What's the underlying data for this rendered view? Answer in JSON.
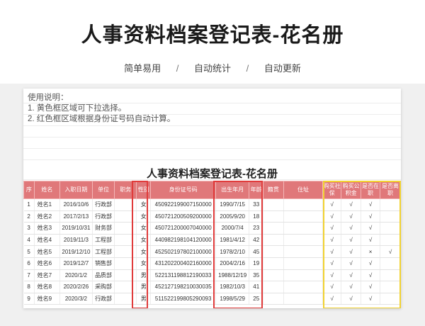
{
  "header": {
    "title": "人事资料档案登记表-花名册",
    "features": [
      "简单易用",
      "自动统计",
      "自动更新"
    ],
    "separator": "/"
  },
  "sheet": {
    "instructions": [
      "使用说明：",
      "1. 黄色框区域可下拉选择。",
      "2. 红色框区域根据身份证号码自动计算。"
    ],
    "title": "人事资料档案登记表-花名册",
    "columns": [
      "序",
      "姓名",
      "入职日期",
      "单位",
      "职务",
      "性别",
      "身份证号码",
      "出生年月",
      "年龄",
      "籍贯",
      "住址",
      "购买社保",
      "购买公积金",
      "是否在职",
      "是否离职"
    ],
    "rows": [
      [
        "1",
        "姓名1",
        "2016/10/6",
        "行政部",
        "",
        "女",
        "450922199007150000",
        "1990/7/15",
        "33",
        "",
        "",
        "√",
        "√",
        "√",
        ""
      ],
      [
        "2",
        "姓名2",
        "2017/2/13",
        "行政部",
        "",
        "女",
        "450721200509200000",
        "2005/9/20",
        "18",
        "",
        "",
        "√",
        "√",
        "√",
        ""
      ],
      [
        "3",
        "姓名3",
        "2019/10/31",
        "财务部",
        "",
        "女",
        "450721200007040000",
        "2000/7/4",
        "23",
        "",
        "",
        "√",
        "√",
        "√",
        ""
      ],
      [
        "4",
        "姓名4",
        "2019/11/3",
        "工程部",
        "",
        "女",
        "440982198104120000",
        "1981/4/12",
        "42",
        "",
        "",
        "√",
        "√",
        "√",
        ""
      ],
      [
        "5",
        "姓名5",
        "2019/12/10",
        "工程部",
        "",
        "女",
        "452502197802100000",
        "1978/2/10",
        "45",
        "",
        "",
        "√",
        "√",
        "×",
        "√"
      ],
      [
        "6",
        "姓名6",
        "2019/12/7",
        "销售部",
        "",
        "女",
        "431202200402160000",
        "2004/2/16",
        "19",
        "",
        "",
        "√",
        "√",
        "√",
        ""
      ],
      [
        "7",
        "姓名7",
        "2020/1/2",
        "品质部",
        "",
        "男",
        "522131198812190033",
        "1988/12/19",
        "35",
        "",
        "",
        "√",
        "√",
        "√",
        ""
      ],
      [
        "8",
        "姓名8",
        "2020/2/26",
        "采购部",
        "",
        "男",
        "452127198210030035",
        "1982/10/3",
        "41",
        "",
        "",
        "√",
        "√",
        "√",
        ""
      ],
      [
        "9",
        "姓名9",
        "2020/3/2",
        "行政部",
        "",
        "男",
        "511522199805290093",
        "1998/5/29",
        "25",
        "",
        "",
        "√",
        "√",
        "√",
        ""
      ]
    ]
  },
  "colors": {
    "header_fill": "#e0787a",
    "red_frame": "#e03b3b",
    "yellow_frame": "#f2d230"
  }
}
